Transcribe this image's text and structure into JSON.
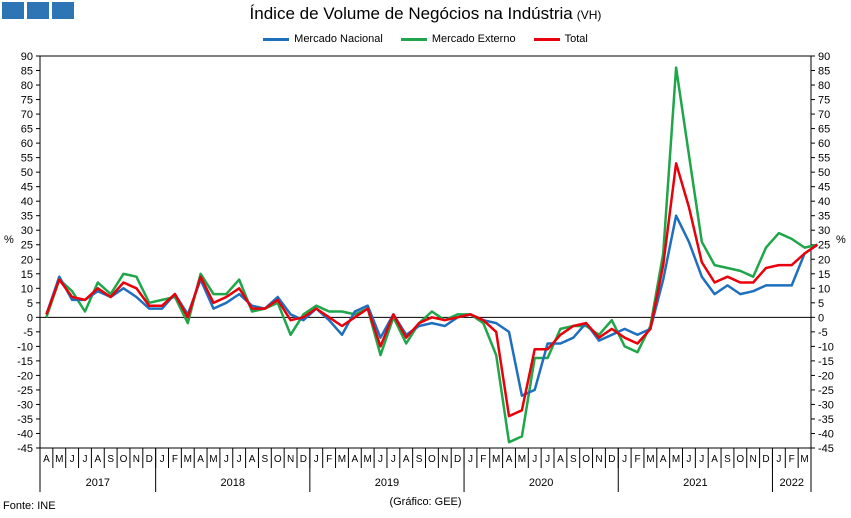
{
  "header": {
    "title": "Índice de Volume de Negócios na Indústria",
    "title_note": "(VH)",
    "logo_color": "#2e75b6"
  },
  "footer": {
    "source": "Fonte: INE",
    "credit": "(Gráfico: GEE)"
  },
  "chart_data": {
    "type": "line",
    "title": "Índice de Volume de Negócios na Indústria",
    "ylabel": "%",
    "ylim": [
      -45,
      90
    ],
    "ytick_step": 5,
    "grid": false,
    "legend_position": "top-center",
    "categories": [
      "A",
      "M",
      "J",
      "J",
      "A",
      "S",
      "O",
      "N",
      "D",
      "J",
      "F",
      "M",
      "A",
      "M",
      "J",
      "J",
      "A",
      "S",
      "O",
      "N",
      "D",
      "J",
      "F",
      "M",
      "A",
      "M",
      "J",
      "J",
      "A",
      "S",
      "O",
      "N",
      "D",
      "J",
      "F",
      "M",
      "A",
      "M",
      "J",
      "J",
      "A",
      "S",
      "O",
      "N",
      "D",
      "J",
      "F",
      "M",
      "A",
      "M",
      "J",
      "J",
      "A",
      "S",
      "O",
      "N",
      "D",
      "J",
      "F",
      "M"
    ],
    "years": [
      {
        "label": "2017",
        "start": 0,
        "end": 8
      },
      {
        "label": "2018",
        "start": 9,
        "end": 20
      },
      {
        "label": "2019",
        "start": 21,
        "end": 32
      },
      {
        "label": "2020",
        "start": 33,
        "end": 44
      },
      {
        "label": "2021",
        "start": 45,
        "end": 56
      },
      {
        "label": "2022",
        "start": 57,
        "end": 59
      }
    ],
    "series": [
      {
        "name": "Mercado Nacional",
        "color": "#1f6fbf",
        "values": [
          1,
          14,
          6,
          6,
          9,
          7,
          10,
          7,
          3,
          3,
          8,
          1,
          13,
          3,
          5,
          8,
          4,
          3,
          7,
          1,
          -1,
          3,
          -1,
          -6,
          2,
          4,
          -7,
          1,
          -6,
          -3,
          -2,
          -3,
          0,
          1,
          -1,
          -2,
          -5,
          -27,
          -25,
          -9,
          -9,
          -7,
          -2,
          -8,
          -6,
          -4,
          -6,
          -4,
          13,
          35,
          26,
          14,
          8,
          11,
          8,
          9,
          11,
          11,
          11,
          22,
          25
        ]
      },
      {
        "name": "Mercado Externo",
        "color": "#1fa64a",
        "values": [
          0,
          13,
          9,
          2,
          12,
          8,
          15,
          14,
          5,
          6,
          7,
          -2,
          15,
          8,
          8,
          13,
          2,
          3,
          5,
          -6,
          1,
          4,
          2,
          2,
          1,
          3,
          -13,
          0,
          -9,
          -2,
          2,
          -1,
          1,
          1,
          -2,
          -13,
          -43,
          -41,
          -14,
          -14,
          -4,
          -3,
          -3,
          -6,
          -1,
          -10,
          -12,
          -3,
          22,
          86,
          56,
          26,
          18,
          17,
          16,
          14,
          24,
          29,
          27,
          24,
          25
        ]
      },
      {
        "name": "Total",
        "color": "#e8000b",
        "values": [
          1,
          13,
          7,
          6,
          10,
          7,
          12,
          10,
          4,
          4,
          8,
          0,
          14,
          5,
          7,
          10,
          3,
          3,
          6,
          -1,
          0,
          3,
          0,
          -3,
          0,
          3,
          -10,
          1,
          -7,
          -2,
          0,
          -1,
          0,
          1,
          -1,
          -5,
          -34,
          -32,
          -11,
          -11,
          -6,
          -3,
          -2,
          -7,
          -4,
          -7,
          -9,
          -4,
          18,
          53,
          38,
          19,
          12,
          14,
          12,
          12,
          17,
          18,
          18,
          22,
          25
        ]
      }
    ]
  }
}
